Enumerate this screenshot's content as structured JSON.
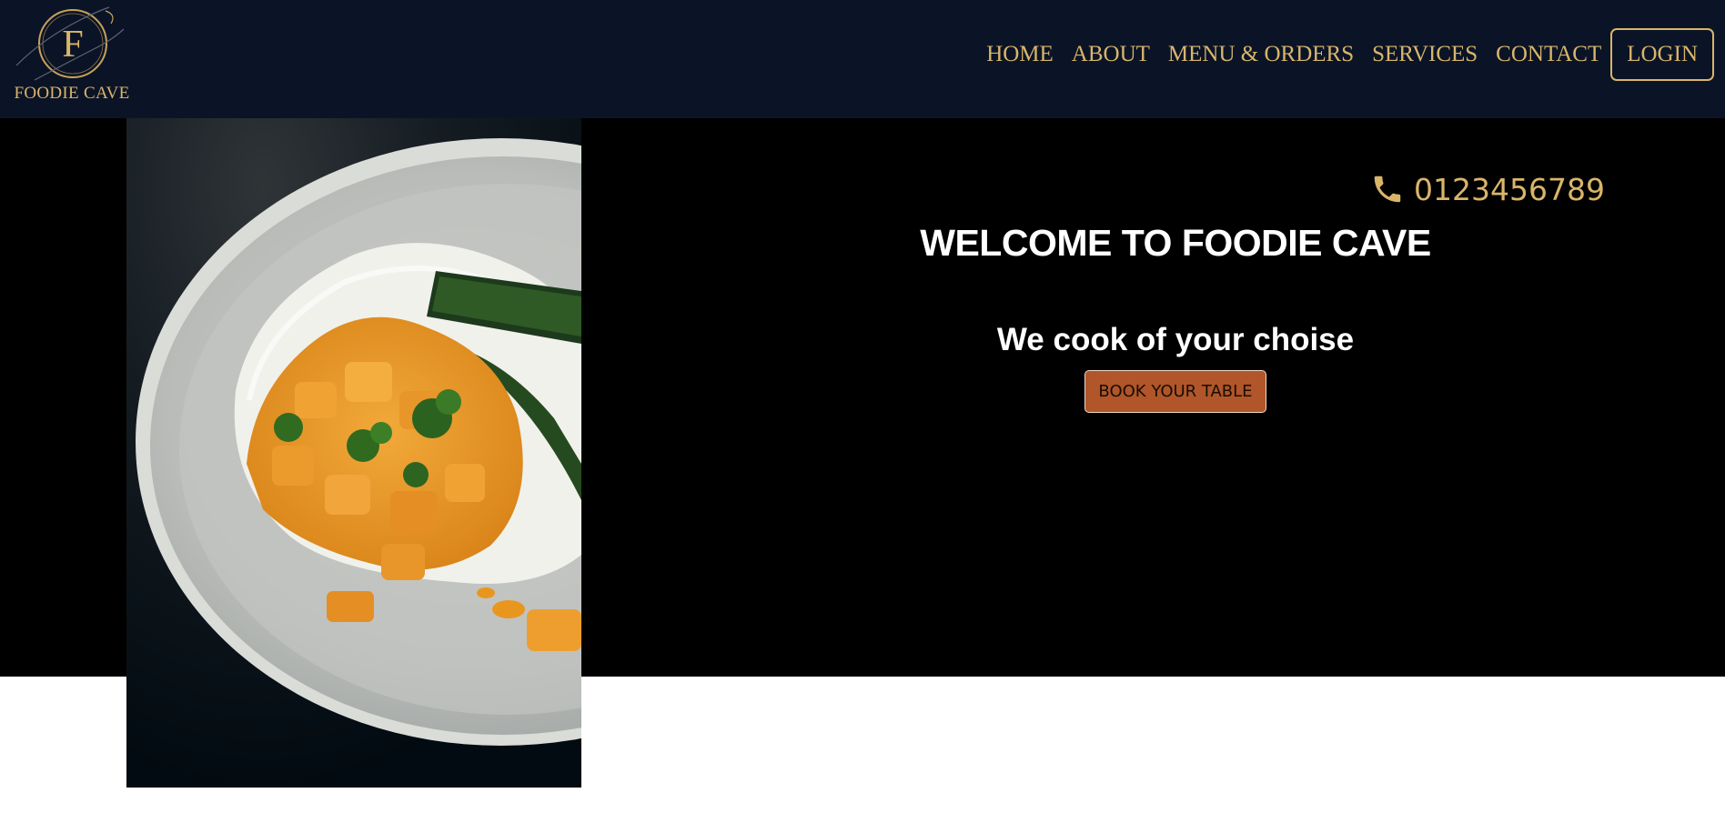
{
  "brand": {
    "logo_letter": "F",
    "name": "FOODIE CAVE"
  },
  "nav": {
    "items": [
      {
        "label": "HOME"
      },
      {
        "label": "ABOUT"
      },
      {
        "label": "MENU & ORDERS"
      },
      {
        "label": "SERVICES"
      },
      {
        "label": "CONTACT"
      }
    ],
    "login_label": "LOGIN"
  },
  "hero": {
    "phone_icon": "phone-icon",
    "phone_number": "0123456789",
    "welcome_heading": "WELCOME TO FOODIE CAVE",
    "tagline": "We cook of your choise",
    "book_button_label": "BOOK YOUR TABLE"
  },
  "colors": {
    "navbar_bg": "#0b1427",
    "accent_gold": "#d9b56a",
    "hero_bg": "#000000",
    "button_bg": "#b0562a"
  }
}
